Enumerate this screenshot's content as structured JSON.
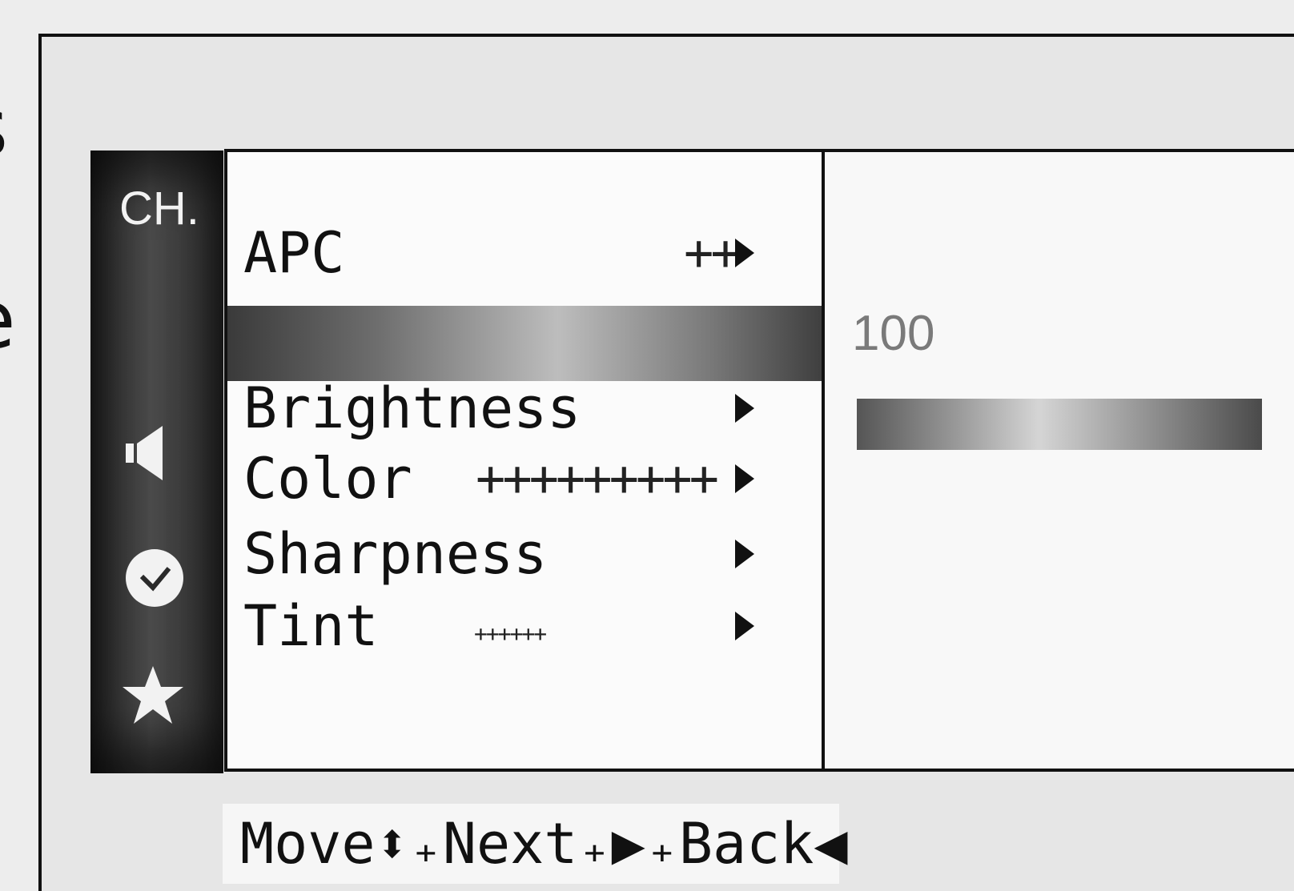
{
  "left_margin": {
    "fragment_1": "s",
    "fragment_2": "e"
  },
  "sidebar": {
    "channel_label": "CH.",
    "icons": [
      "speaker-icon",
      "clock-icon",
      "star-icon"
    ]
  },
  "menu": {
    "items": [
      {
        "label": "APC",
        "ticks": "++"
      },
      {
        "label": "",
        "highlighted": true
      },
      {
        "label": "Brightness",
        "ticks": ""
      },
      {
        "label": "Color",
        "ticks": "+++++++++"
      },
      {
        "label": "Sharpness",
        "ticks": ""
      },
      {
        "label": "Tint",
        "ticks": "++++++"
      }
    ]
  },
  "value_panel": {
    "value": "100",
    "level_fraction": 1.0
  },
  "nav_hint": {
    "text": "Move⬍₊Next₊▶₊Back◀"
  },
  "colors": {
    "text": "#111111",
    "panel_bg": "#fbfbfb",
    "sidebar_bg": "#333333",
    "value_number": "#7a7a7a"
  }
}
